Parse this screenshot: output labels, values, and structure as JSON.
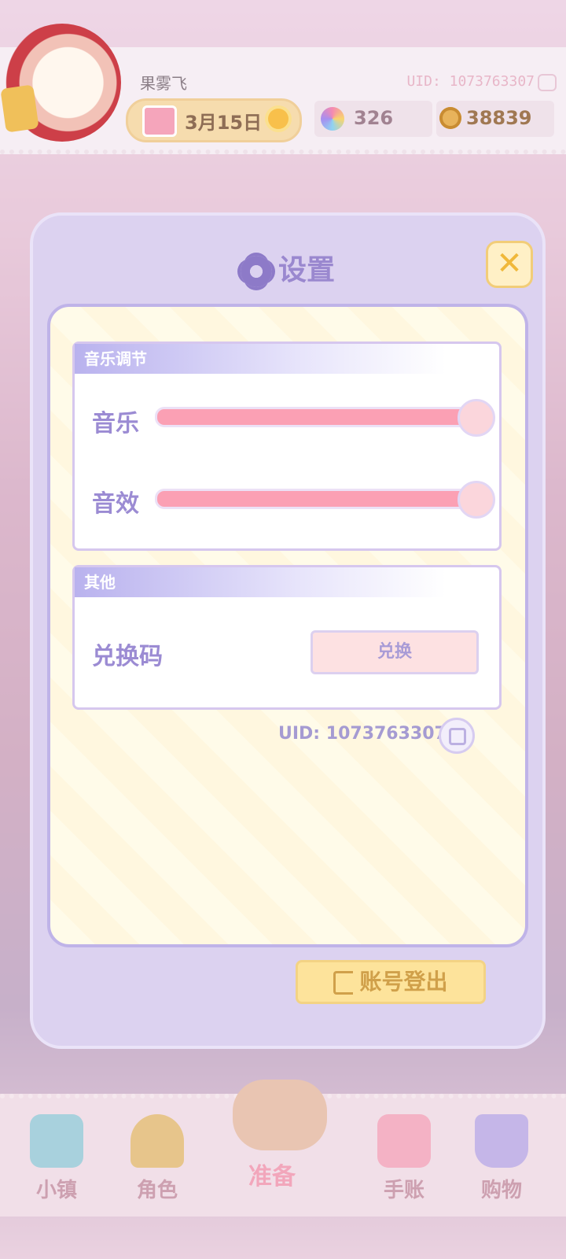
{
  "header": {
    "username": "果雾飞",
    "uid_label": "UID: 1073763307",
    "date": "3月15日",
    "gems": "326",
    "coins": "38839"
  },
  "settings": {
    "title": "设置",
    "close_label": "✕",
    "music_section": {
      "title": "音乐调节",
      "music_label": "音乐",
      "music_level": 1.0,
      "sfx_label": "音效",
      "sfx_level": 1.0
    },
    "other_section": {
      "title": "其他",
      "code_label": "兑换码",
      "redeem_button": "兑换"
    },
    "uid_label": "UID: 1073763307",
    "logout_button": "账号登出"
  },
  "nav": {
    "items": [
      {
        "label": "小镇",
        "icon": "map-icon"
      },
      {
        "label": "角色",
        "icon": "character-icon"
      },
      {
        "label": "准备",
        "icon": "basket-icon"
      },
      {
        "label": "手账",
        "icon": "journal-icon"
      },
      {
        "label": "购物",
        "icon": "shopping-bag-icon"
      }
    ]
  },
  "colors": {
    "accent_purple": "#9b8bd3",
    "slider_pink": "#fba0b4",
    "logout_yellow": "#fde39b"
  }
}
